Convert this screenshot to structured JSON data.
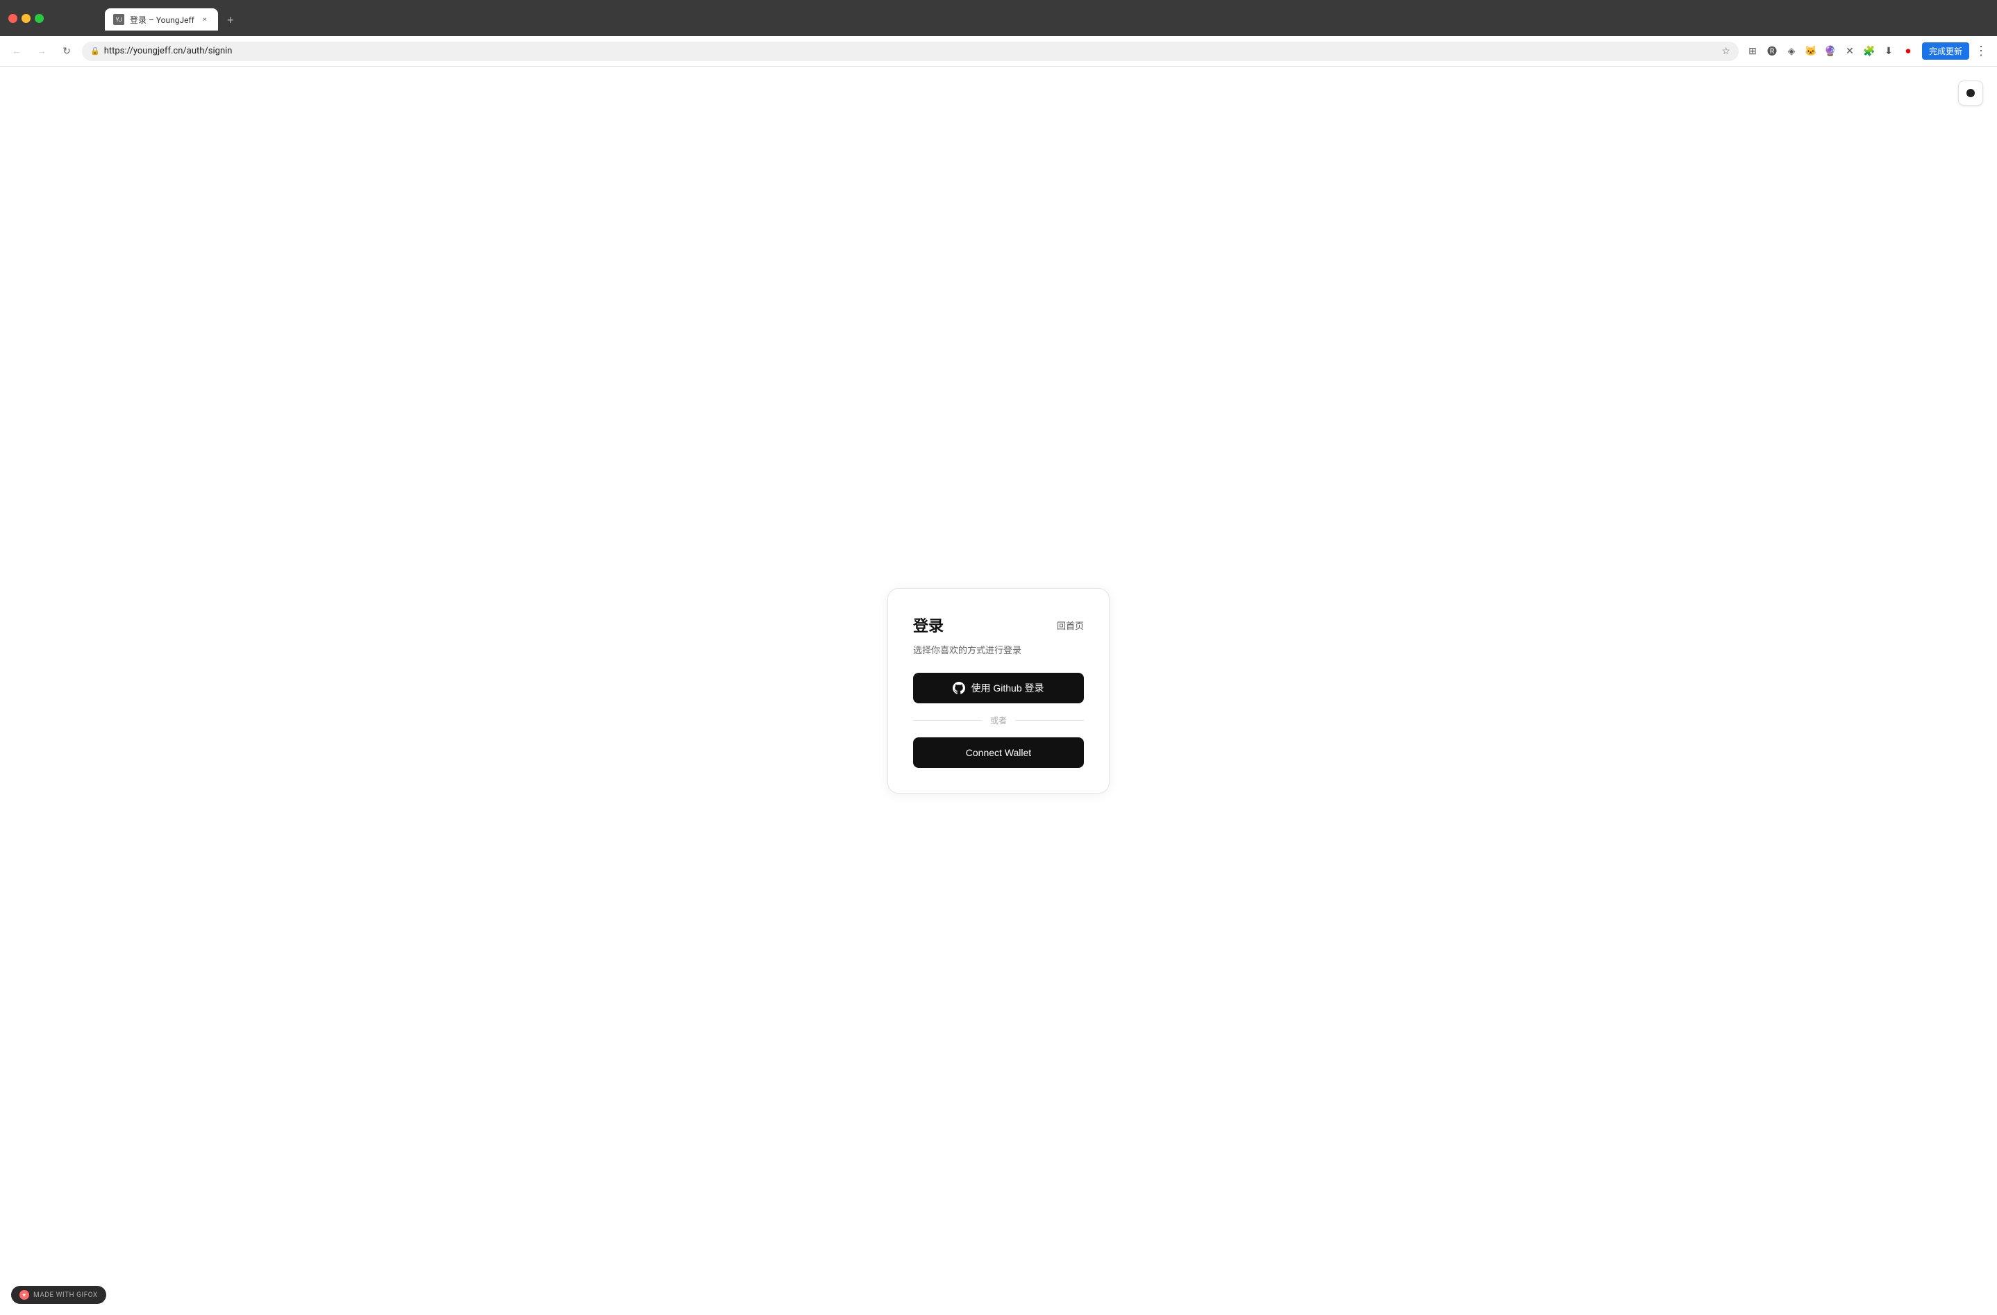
{
  "browser": {
    "tab": {
      "favicon_label": "YJ",
      "title": "登录 – YoungJeff",
      "close_label": "×",
      "new_tab_label": "+"
    },
    "nav": {
      "back_label": "←",
      "forward_label": "→",
      "reload_label": "↻",
      "url": "https://youngjeff.cn/auth/signin",
      "star_label": "☆",
      "update_button_label": "完成更新",
      "more_label": "⋮"
    }
  },
  "theme_toggle": {
    "aria_label": "Toggle theme"
  },
  "login_card": {
    "title": "登录",
    "back_link_label": "回首页",
    "subtitle": "选择你喜欢的方式进行登录",
    "github_button_label": "使用 Github 登录",
    "divider_text": "或者",
    "wallet_button_label": "Connect Wallet"
  },
  "footer": {
    "badge_label": "MADE WITH GIFOX"
  }
}
